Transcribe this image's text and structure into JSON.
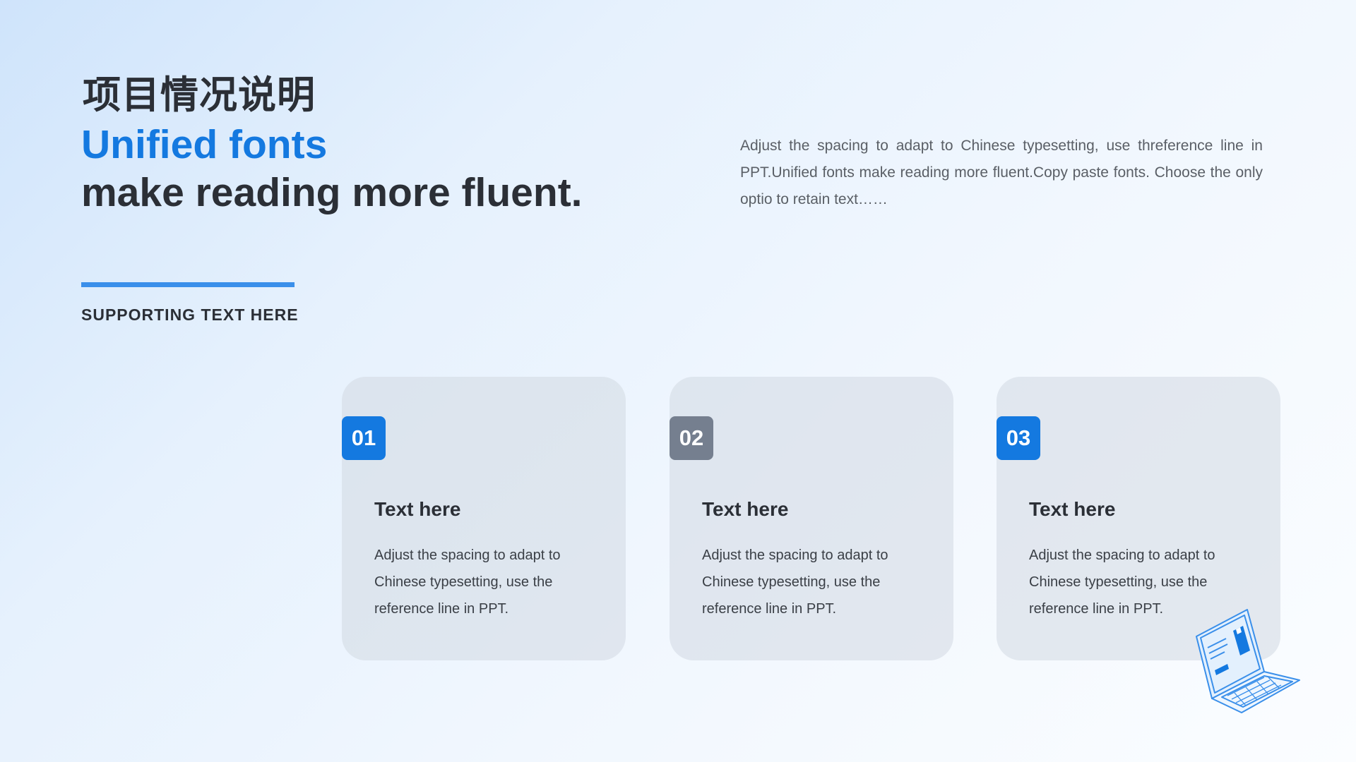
{
  "title_cn": "项目情况说明",
  "headline": {
    "line1": "Unified fonts",
    "line2": "make reading more fluent."
  },
  "intro_text": "Adjust the spacing to adapt to Chinese typesetting, use threference line in PPT.Unified fonts make reading more fluent.Copy paste fonts. Choose the only optio to retain text……",
  "supporting_text": "SUPPORTING TEXT HERE",
  "cards": [
    {
      "number": "01",
      "badge_color": "#1479e0",
      "title": "Text here",
      "text": "Adjust the spacing to adapt to Chinese typesetting, use the reference line in PPT."
    },
    {
      "number": "02",
      "badge_color": "#757f8f",
      "title": "Text here",
      "text": "Adjust the spacing to adapt to Chinese typesetting, use the reference line in PPT."
    },
    {
      "number": "03",
      "badge_color": "#1479e0",
      "title": "Text here",
      "text": "Adjust the spacing to adapt to Chinese typesetting, use the reference line in PPT."
    }
  ],
  "colors": {
    "accent": "#1479e0",
    "accent_line": "#3a8fea",
    "heading": "#2b2f36",
    "body_text": "#5a5f66"
  },
  "decoration_icon": "laptop-icon"
}
